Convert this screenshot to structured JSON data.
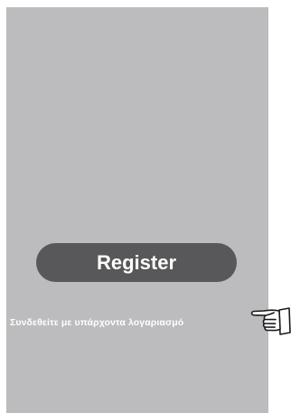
{
  "register": {
    "label": "Register"
  },
  "login": {
    "label": "Συνδεθείτε με υπάρχοντα λογαριασμό"
  },
  "icons": {
    "pointer": "pointing-hand-icon"
  },
  "colors": {
    "screen_background": "#bcbcbe",
    "button_background": "#58585a",
    "text": "#ffffff"
  }
}
